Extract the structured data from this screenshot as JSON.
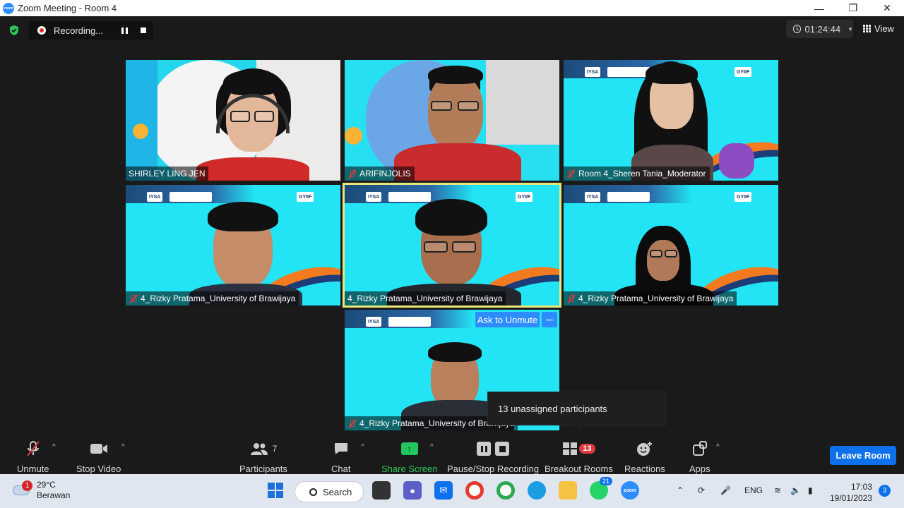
{
  "window": {
    "title": "Zoom Meeting - Room 4",
    "logo": "zoom"
  },
  "recording": {
    "label": "Recording..."
  },
  "timer": {
    "value": "01:24:44"
  },
  "view": {
    "label": "View"
  },
  "tiles": [
    {
      "name": "SHIRLEY LING JEN",
      "muted": false
    },
    {
      "name": "ARIFINJOLIS",
      "muted": true
    },
    {
      "name": "Room 4_Sheren Tania_Moderator",
      "muted": true
    },
    {
      "name": "4_Rizky Pratama_University of Brawijaya",
      "muted": true
    },
    {
      "name": "4_Rizky Pratama_University of Brawijaya",
      "muted": false,
      "active_speaker": true
    },
    {
      "name": "4_Rizky Pratama_University of Brawijaya",
      "muted": true
    },
    {
      "name": "4_Rizky Pratama_University of Brawijaya",
      "muted": true
    }
  ],
  "banner_logos": {
    "iysa": "IYSA",
    "gyiif": "GYIIF"
  },
  "tile_actions": {
    "ask_unmute": "Ask to Unmute",
    "more": "···"
  },
  "tooltip": {
    "text": "13 unassigned participants"
  },
  "controls": {
    "unmute": "Unmute",
    "stop_video": "Stop Video",
    "participants": "Participants",
    "participants_count": "7",
    "chat": "Chat",
    "share_screen": "Share Screen",
    "pause_recording": "Pause/Stop Recording",
    "breakout_rooms": "Breakout Rooms",
    "breakout_count": "13",
    "reactions": "Reactions",
    "apps": "Apps",
    "leave": "Leave Room"
  },
  "taskbar": {
    "weather_temp": "29°C",
    "weather_desc": "Berawan",
    "weather_badge": "1",
    "search": "Search",
    "whatsapp_badge": "21",
    "language": "ENG",
    "time": "17:03",
    "date": "19/01/2023",
    "notifications": "3"
  },
  "colors": {
    "accent": "#2d8cff",
    "share_green": "#22c55e",
    "muted_red": "#e0393e",
    "tile_bg": "#22e4f4"
  }
}
